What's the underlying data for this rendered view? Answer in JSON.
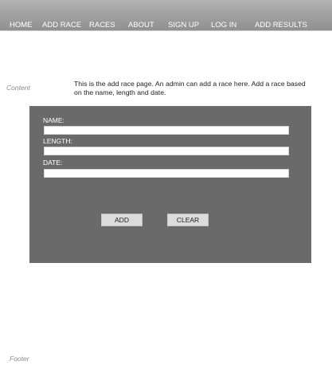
{
  "nav": {
    "items": [
      {
        "label": "HOME"
      },
      {
        "label": "ADD RACE"
      },
      {
        "label": "RACES"
      },
      {
        "label": "ABOUT"
      },
      {
        "label": "SIGN UP"
      },
      {
        "label": "LOG IN"
      },
      {
        "label": "ADD RESULTS"
      }
    ]
  },
  "content": {
    "section_label": "Content",
    "intro": "This is the add race page. An admin can add a race here. Add a race based on the name, length and date."
  },
  "form": {
    "name_label": "NAME:",
    "name_value": "",
    "length_label": "LENGTH:",
    "length_value": "",
    "date_label": "DATE:",
    "date_value": "",
    "add_button": "ADD",
    "clear_button": "CLEAR"
  },
  "footer": {
    "label": "Footer"
  }
}
